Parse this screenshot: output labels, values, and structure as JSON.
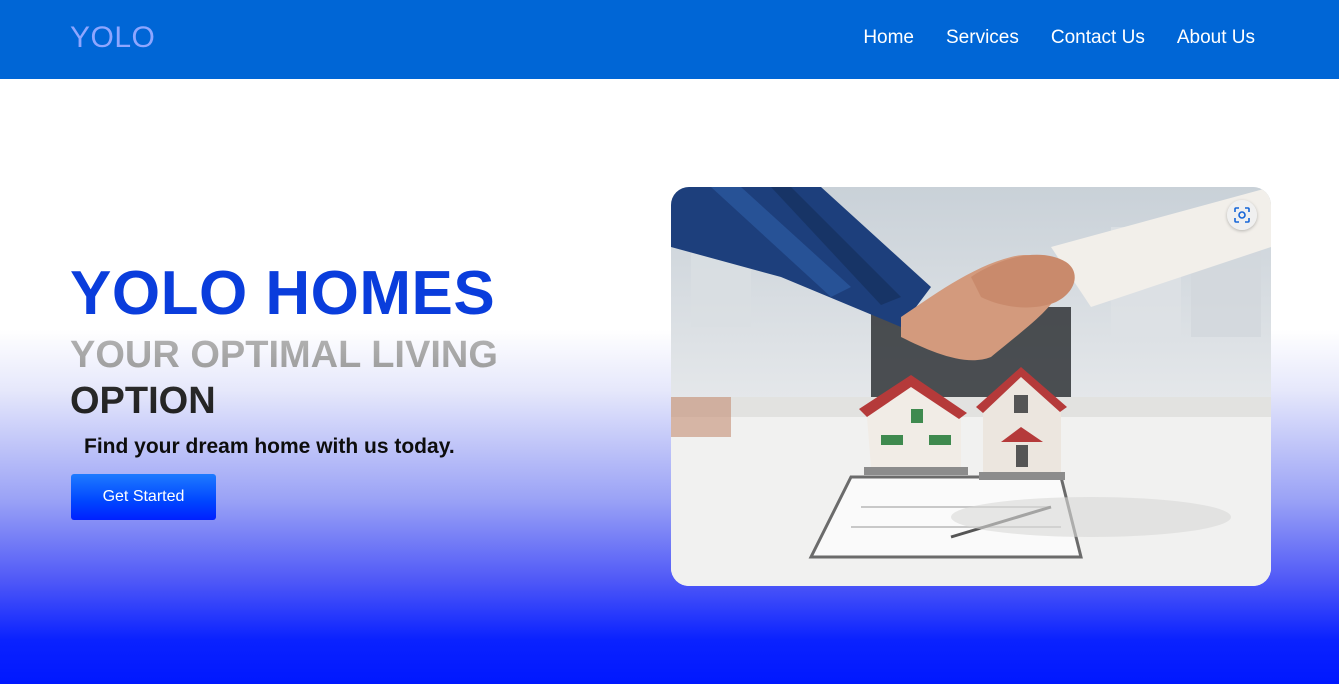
{
  "nav": {
    "logo": "YOLO",
    "links": [
      "Home",
      "Services",
      "Contact Us",
      "About Us"
    ]
  },
  "hero": {
    "title": "YOLO HOMES",
    "subtitle": "YOUR OPTIMAL LIVING OPTION",
    "tagline": "Find your dream home with us today.",
    "cta_label": "Get Started",
    "image_icons": [
      "visual-search-icon"
    ]
  },
  "colors": {
    "navbar": "#0066d6",
    "logo": "#8ea6ff",
    "title": "#0a3ddc",
    "cta": "#0045ff",
    "gradient_bottom": "#0018ff"
  }
}
